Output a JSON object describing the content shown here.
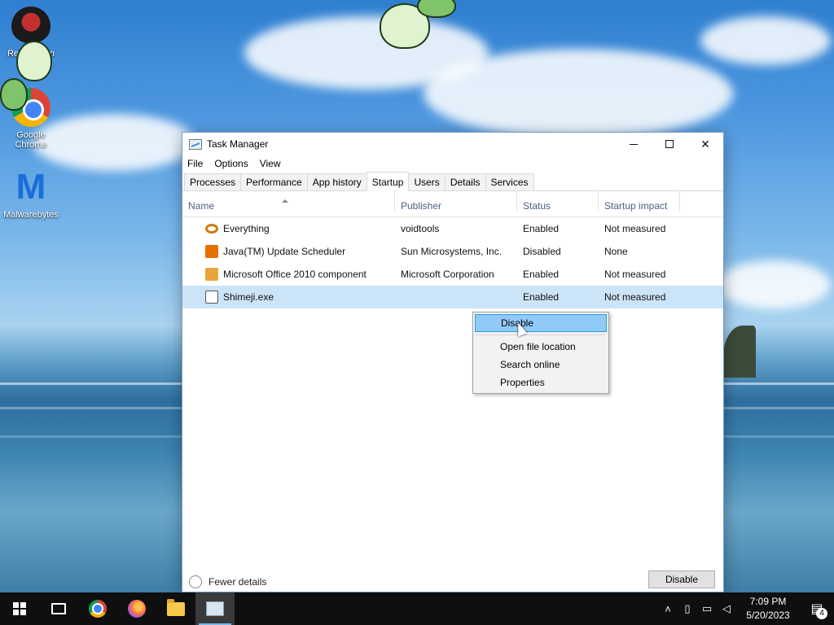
{
  "desktop": {
    "icons": [
      {
        "label": "Recycle Bin",
        "icon": "recycle-bin-icon"
      },
      {
        "label": "Google Chrome",
        "icon": "chrome-icon"
      },
      {
        "label": "Malwarebytes",
        "icon": "malwarebytes-icon"
      }
    ]
  },
  "window": {
    "title": "Task Manager",
    "controls": {
      "minimize": "minimize-icon",
      "maximize": "maximize-icon",
      "close": "✕"
    },
    "menu": [
      "File",
      "Options",
      "View"
    ],
    "tabs": [
      "Processes",
      "Performance",
      "App history",
      "Startup",
      "Users",
      "Details",
      "Services"
    ],
    "active_tab": "Startup",
    "columns": [
      "Name",
      "Publisher",
      "Status",
      "Startup impact"
    ],
    "rows": [
      {
        "name": "Everything",
        "publisher": "voidtools",
        "status": "Enabled",
        "impact": "Not measured",
        "icon": "search-icon"
      },
      {
        "name": "Java(TM) Update Scheduler",
        "publisher": "Sun Microsystems, Inc.",
        "status": "Disabled",
        "impact": "None",
        "icon": "java-icon"
      },
      {
        "name": "Microsoft Office 2010 component",
        "publisher": "Microsoft Corporation",
        "status": "Enabled",
        "impact": "Not measured",
        "icon": "office-icon"
      },
      {
        "name": "Shimeji.exe",
        "publisher": "",
        "status": "Enabled",
        "impact": "Not measured",
        "icon": "exe-icon"
      }
    ],
    "footer": {
      "fewer_details": "Fewer details",
      "button": "Disable"
    }
  },
  "context_menu": {
    "items": [
      "Disable",
      "Open file location",
      "Search online",
      "Properties"
    ]
  },
  "taskbar": {
    "time": "7:09 PM",
    "date": "5/20/2023",
    "notification_count": "4"
  }
}
